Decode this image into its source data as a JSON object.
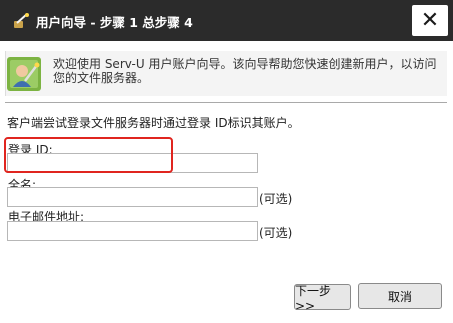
{
  "window": {
    "title": "用户向导 - 步骤 1 总步骤 4",
    "close_label": "✕"
  },
  "banner": {
    "text": "欢迎使用 Serv-U 用户账户向导。该向导帮助您快速创建新用户，以访问您的文件服务器。"
  },
  "intro_text": "客户端尝试登录文件服务器时通过登录 ID标识其账户。",
  "form": {
    "login_id": {
      "label": "登录 ID:",
      "value": ""
    },
    "full_name": {
      "label": "全名:",
      "value": "",
      "optional": "(可选)"
    },
    "email": {
      "label": "电子邮件地址:",
      "value": "",
      "optional": "(可选)"
    }
  },
  "buttons": {
    "next": "下一步>>",
    "cancel": "取消"
  },
  "colors": {
    "titlebar": "#2b2b2b",
    "highlight": "#e0251f"
  }
}
